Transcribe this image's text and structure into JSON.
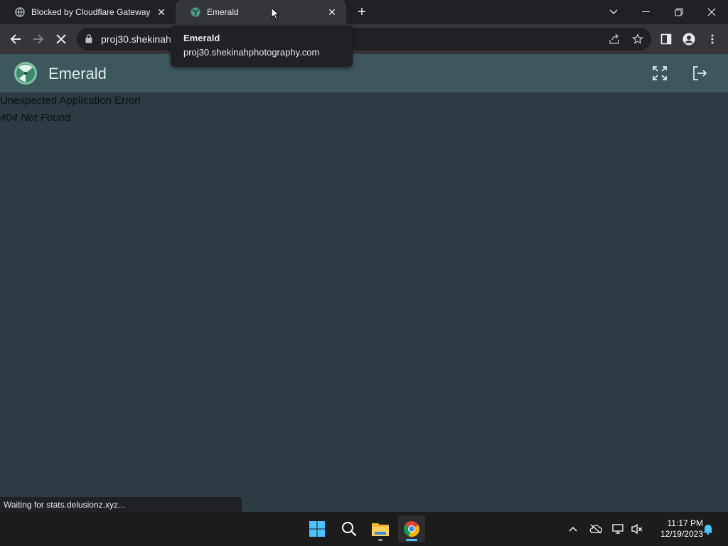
{
  "browser": {
    "tabs": [
      {
        "title": "Blocked by Cloudflare Gateway",
        "icon": "globe-icon",
        "active": false
      },
      {
        "title": "Emerald",
        "icon": "emerald-logo-icon",
        "active": true
      }
    ],
    "new_tab_icon": "plus-icon",
    "address_bar": {
      "url": "proj30.shekinah",
      "icon": "lock-icon"
    },
    "tooltip": {
      "title": "Emerald",
      "url": "proj30.shekinahphotography.com"
    },
    "status_text": "Waiting for stats.delusionz.xyz..."
  },
  "app": {
    "title": "Emerald",
    "header_icons": [
      "fullscreen-icon",
      "logout-icon"
    ],
    "error": {
      "title": "Unexpected Application Error!",
      "detail": "404 Not Found"
    }
  },
  "taskbar": {
    "apps": [
      "windows-start-icon",
      "search-icon",
      "file-explorer-icon",
      "chrome-icon"
    ],
    "tray_icons": [
      "chevron-up-icon",
      "cloud-offline-icon",
      "network-icon",
      "volume-muted-icon",
      "notification-bell-icon"
    ],
    "time": "11:17 PM",
    "date": "12/19/2023"
  },
  "colors": {
    "page_bg": "#2d3b42",
    "app_header_bg": "#3d575c",
    "browser_dark": "#202124",
    "browser_toolbar": "#35363a",
    "accent_blue": "#4cc2ff"
  }
}
